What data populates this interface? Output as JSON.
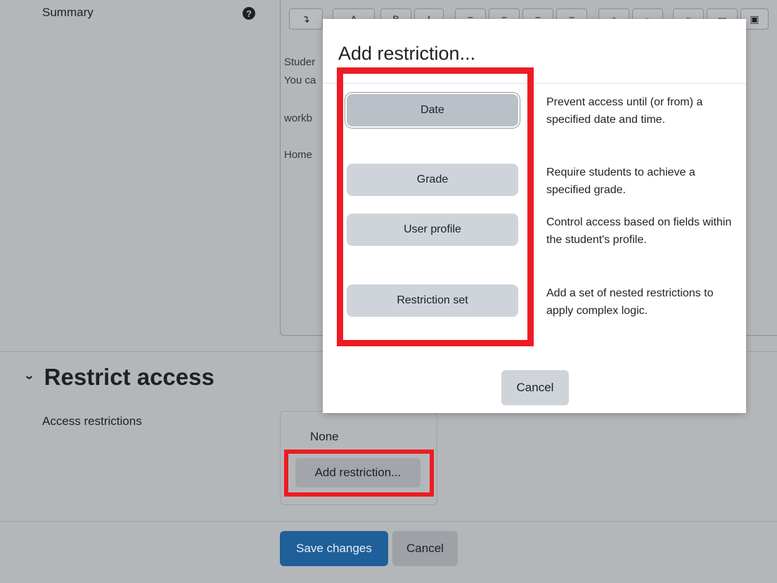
{
  "form": {
    "summary_label": "Summary",
    "help_icon": "?",
    "editor": {
      "toolbar_first": "↴",
      "toolbar_glyphs": [
        "A",
        "B",
        "I",
        "≡",
        "≡",
        "≡",
        "≡",
        "⌂",
        "⌁",
        "○",
        "▭",
        "▣"
      ],
      "lines": [
        "Studer",
        "You ca",
        "workb",
        "Home"
      ]
    },
    "section_title": "Restrict access",
    "section_chevron": "›",
    "access_label": "Access restrictions",
    "none_text": "None",
    "add_restriction_label": "Add restriction...",
    "save_label": "Save changes",
    "cancel_label": "Cancel"
  },
  "modal": {
    "title": "Add restriction...",
    "options": [
      {
        "label": "Date",
        "description": "Prevent access until (or from) a specified date and time."
      },
      {
        "label": "Grade",
        "description": "Require students to achieve a specified grade."
      },
      {
        "label": "User profile",
        "description": "Control access based on fields within the student's profile."
      },
      {
        "label": "Restriction set",
        "description": "Add a set of nested restrictions to apply complex logic."
      }
    ],
    "cancel_label": "Cancel"
  },
  "colors": {
    "highlight": "#ed1c24",
    "primary": "#1f5f9a",
    "overlay": "#b4b7b9"
  }
}
